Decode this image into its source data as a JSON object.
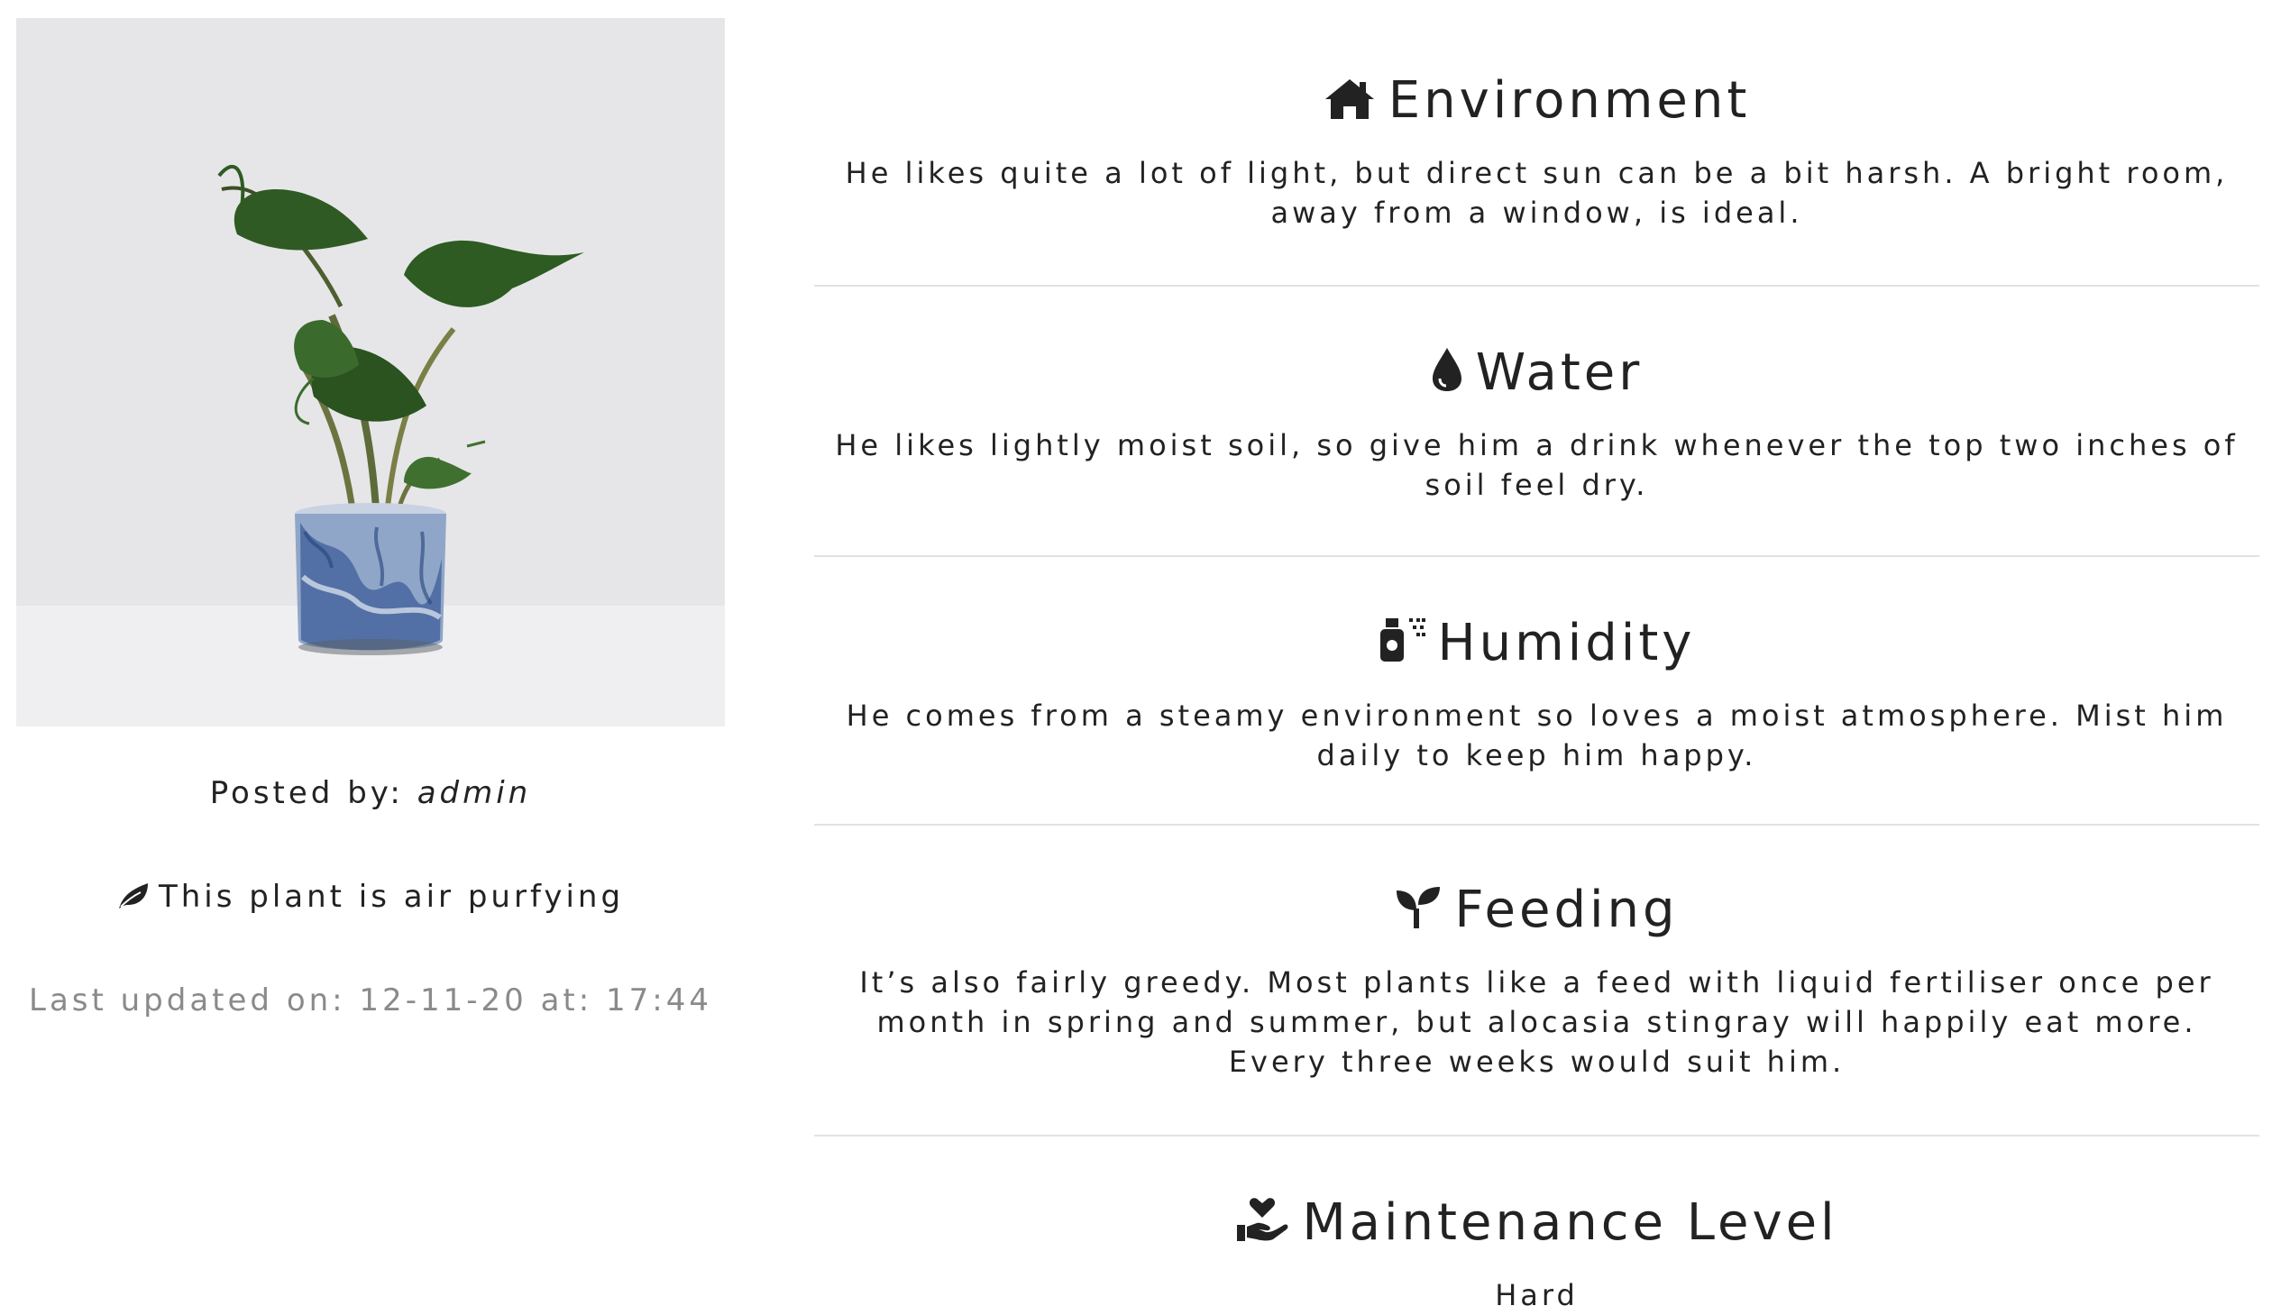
{
  "post": {
    "posted_by_label": "Posted by:",
    "author": "admin",
    "air_purifying_text": "This plant is air purfying",
    "last_updated": "Last updated on: 12-11-20 at: 17:44"
  },
  "sections": [
    {
      "title": "Environment",
      "icon": "home-icon",
      "text": "He likes quite a lot of light, but direct sun can be a bit harsh. A bright room, away from a window, is ideal."
    },
    {
      "title": "Water",
      "icon": "water-drop-icon",
      "text": "He likes lightly moist soil, so give him a drink whenever the top two inches of soil feel dry."
    },
    {
      "title": "Humidity",
      "icon": "spray-bottle-icon",
      "text": "He comes from a steamy environment so loves a moist atmosphere. Mist him daily to keep him happy."
    },
    {
      "title": "Feeding",
      "icon": "seedling-icon",
      "text": "It’s also fairly greedy. Most plants like a feed with liquid fertiliser once per month in spring and summer, but alocasia stingray will happily eat more. Every three weeks would suit him."
    },
    {
      "title": "Maintenance Level",
      "icon": "hand-holding-heart-icon",
      "text": "Hard"
    }
  ],
  "colors": {
    "text": "#222222",
    "muted": "#8a8a8a",
    "divider": "#e2e2e2",
    "photo_bg": "#e6e6e8"
  }
}
